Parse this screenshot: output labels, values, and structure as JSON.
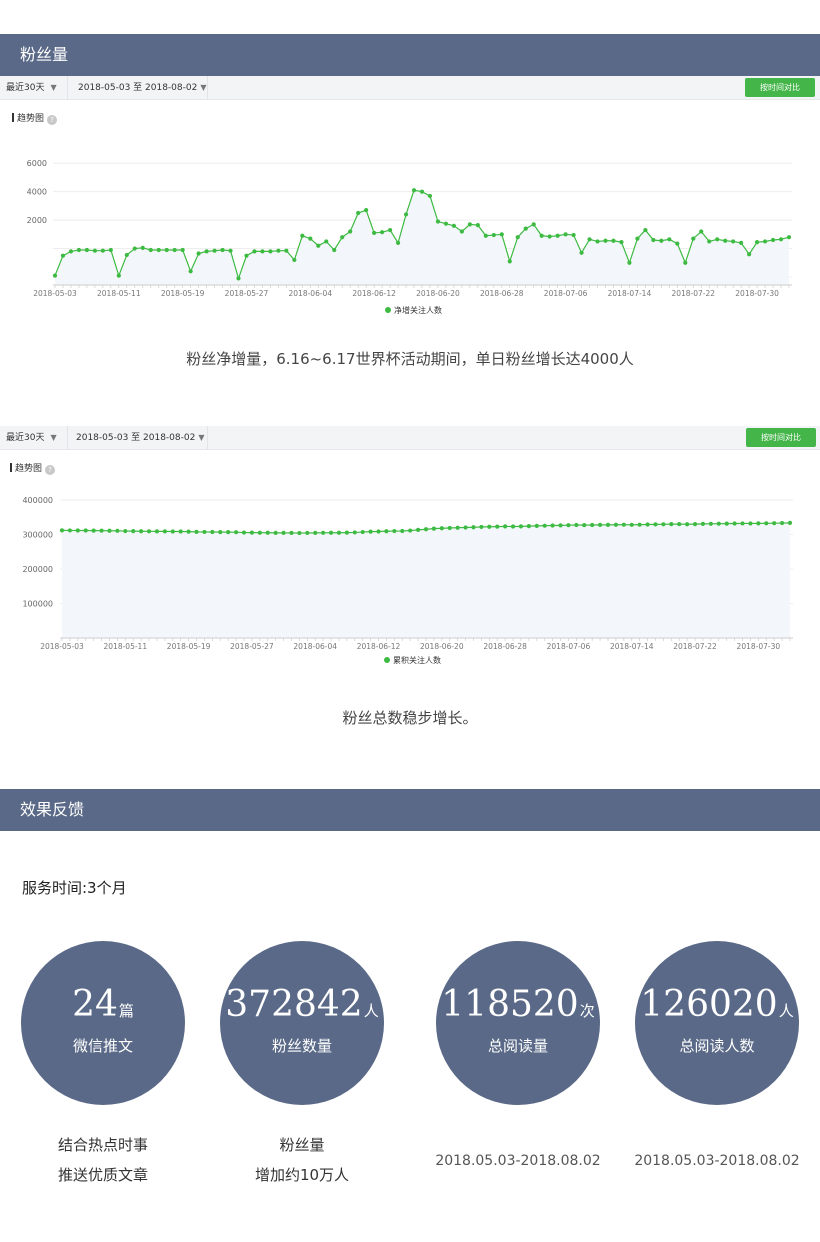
{
  "sections": {
    "fans_title": "粉丝量",
    "feedback_title": "效果反馈"
  },
  "toolbar": {
    "period": "最近30天",
    "date_range": "2018-05-03 至 2018-08-02",
    "compare_button": "按时间对比"
  },
  "trend_label": "趋势图",
  "help_icon_glyph": "?",
  "icons": {
    "dropdown": "triangle-down-icon",
    "help": "question-circle-icon",
    "legend": "dot-icon"
  },
  "colors": {
    "header_bar": "#5a6987",
    "accent_green": "#44b549",
    "series_line": "#3dba42"
  },
  "captions": {
    "chart1": "粉丝净增量，6.16~6.17世界杯活动期间，单日粉丝增长达4000人",
    "chart2": "粉丝总数稳步增长。"
  },
  "service_time": "服务时间:3个月",
  "stats": [
    {
      "value": "24",
      "unit": "篇",
      "label": "微信推文",
      "desc": [
        "结合热点时事",
        "推送优质文章"
      ]
    },
    {
      "value": "372842",
      "unit": "人",
      "label": "粉丝数量",
      "desc": [
        "粉丝量",
        "增加约10万人"
      ]
    },
    {
      "value": "118520",
      "unit": "次",
      "label": "总阅读量",
      "desc": [
        "2018.05.03-2018.08.02"
      ]
    },
    {
      "value": "126020",
      "unit": "人",
      "label": "总阅读人数",
      "desc": [
        "2018.05.03-2018.08.02"
      ]
    }
  ],
  "chart_data": [
    {
      "type": "line",
      "title": "",
      "legend": "净增关注人数",
      "legend_position": "bottom-center",
      "grid": true,
      "x_ticks": [
        "2018-05-03",
        "2018-05-11",
        "2018-05-19",
        "2018-05-27",
        "2018-06-04",
        "2018-06-12",
        "2018-06-20",
        "2018-06-28",
        "2018-07-06",
        "2018-07-14",
        "2018-07-22",
        "2018-07-30"
      ],
      "y_ticks": [
        2000,
        4000,
        6000
      ],
      "ylim": [
        -2000,
        7000
      ],
      "x_start": "2018-05-03",
      "series": [
        {
          "name": "净增关注人数",
          "values": [
            -1900,
            -500,
            -200,
            -100,
            -100,
            -150,
            -150,
            -100,
            -1900,
            -450,
            0,
            50,
            -100,
            -100,
            -100,
            -100,
            -100,
            -1600,
            -350,
            -200,
            -150,
            -100,
            -150,
            -2100,
            -500,
            -200,
            -200,
            -200,
            -150,
            -150,
            -800,
            900,
            700,
            200,
            500,
            -100,
            800,
            1200,
            2500,
            2700,
            1100,
            1150,
            1300,
            400,
            2400,
            4100,
            4000,
            3700,
            1900,
            1750,
            1600,
            1200,
            1700,
            1650,
            900,
            950,
            1000,
            -900,
            800,
            1400,
            1700,
            900,
            850,
            900,
            1000,
            950,
            -300,
            650,
            500,
            550,
            550,
            450,
            -1000,
            700,
            1300,
            600,
            550,
            650,
            350,
            -1000,
            700,
            1200,
            500,
            650,
            550,
            500,
            400,
            -400,
            450,
            500,
            600,
            650,
            800
          ]
        }
      ]
    },
    {
      "type": "line",
      "title": "",
      "legend": "累积关注人数",
      "legend_position": "bottom-center",
      "grid": true,
      "x_ticks": [
        "2018-05-03",
        "2018-05-11",
        "2018-05-19",
        "2018-05-27",
        "2018-06-04",
        "2018-06-12",
        "2018-06-20",
        "2018-06-28",
        "2018-07-06",
        "2018-07-14",
        "2018-07-22",
        "2018-07-30"
      ],
      "y_ticks": [
        100000,
        200000,
        300000,
        400000
      ],
      "ylim": [
        0,
        400000
      ],
      "x_start": "2018-05-03",
      "series": [
        {
          "name": "累积关注人数",
          "values": [
            312000,
            311800,
            311700,
            311500,
            311300,
            311100,
            310900,
            310700,
            310000,
            309700,
            309500,
            309300,
            309100,
            309000,
            308800,
            308600,
            308400,
            307600,
            307400,
            307200,
            307000,
            306800,
            306700,
            305600,
            305400,
            305200,
            305000,
            304800,
            304700,
            304600,
            304200,
            304500,
            304800,
            304900,
            305100,
            305100,
            305500,
            306000,
            307100,
            308300,
            308800,
            309400,
            310000,
            310200,
            311400,
            313400,
            315300,
            317100,
            318100,
            318900,
            319700,
            320300,
            321100,
            321900,
            322400,
            322900,
            323500,
            323100,
            323500,
            324200,
            325000,
            325500,
            326000,
            326500,
            327000,
            327500,
            327300,
            327600,
            327800,
            328000,
            328300,
            328500,
            328100,
            328400,
            329000,
            329300,
            329600,
            330000,
            330200,
            329800,
            330100,
            330700,
            331000,
            331300,
            331600,
            331900,
            332100,
            332000,
            332200,
            332500,
            332800,
            333200,
            333600
          ]
        }
      ]
    }
  ]
}
